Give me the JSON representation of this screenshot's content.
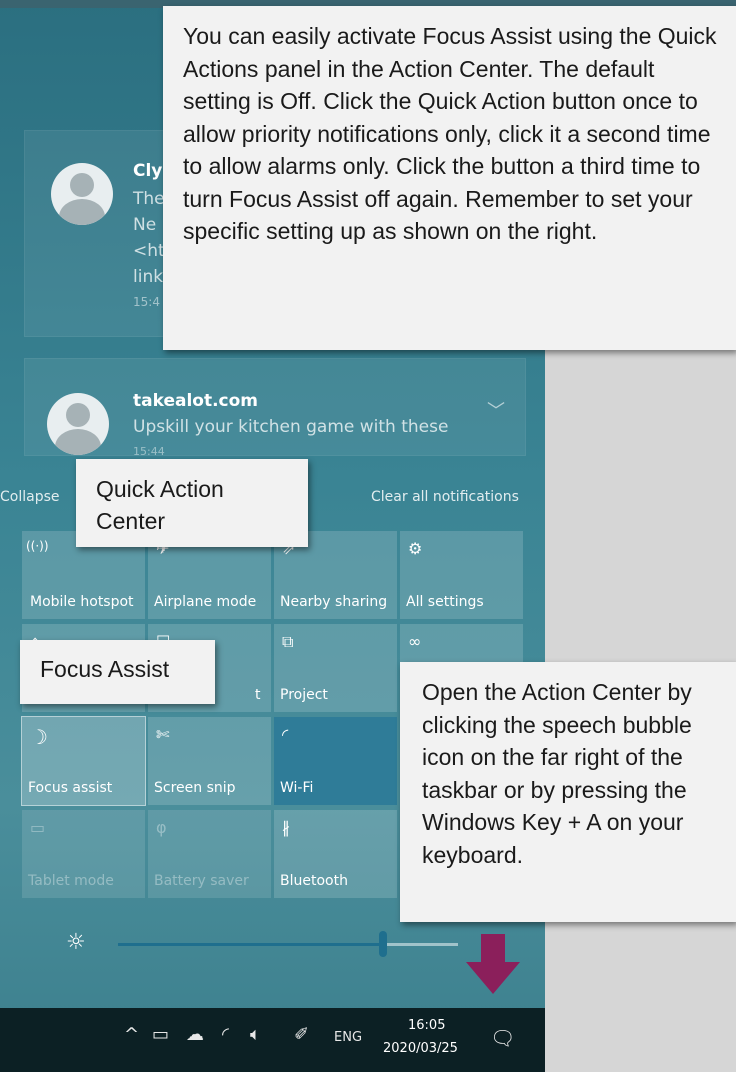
{
  "notifications": [
    {
      "sender": "Cly",
      "lines": [
        "The",
        "Ne",
        "<ht",
        "link"
      ],
      "time": "15:4"
    },
    {
      "sender": "takealot.com",
      "lines": [
        "Upskill your kitchen game with these"
      ],
      "time": "15:44"
    }
  ],
  "action_center": {
    "collapse_label": "Collapse",
    "clear_label": "Clear all notifications",
    "tiles": [
      {
        "label": "Mobile hotspot",
        "icon": "mobile-hotspot-icon",
        "glyph": "((·))"
      },
      {
        "label": "Airplane mode",
        "icon": "airplane-icon",
        "glyph": "✈"
      },
      {
        "label": "Nearby sharing",
        "icon": "nearby-sharing-icon",
        "glyph": "⇗"
      },
      {
        "label": "All settings",
        "icon": "gear-icon",
        "glyph": "⚙"
      },
      {
        "label": "",
        "icon": "location-icon",
        "glyph": "⌂"
      },
      {
        "label": "t",
        "icon": "night-light-icon",
        "glyph": "☐"
      },
      {
        "label": "Project",
        "icon": "project-icon",
        "glyph": "⧉"
      },
      {
        "label": "",
        "icon": "network-icon",
        "glyph": "∞"
      },
      {
        "label": "Focus assist",
        "icon": "moon-icon",
        "glyph": "☽"
      },
      {
        "label": "Screen snip",
        "icon": "scissors-icon",
        "glyph": "✄"
      },
      {
        "label": "Wi-Fi",
        "icon": "wifi-icon",
        "glyph": "◜"
      },
      {
        "label": "Tablet mode",
        "icon": "tablet-icon",
        "glyph": "▭"
      },
      {
        "label": "Battery saver",
        "icon": "battery-saver-icon",
        "glyph": "φ"
      },
      {
        "label": "Bluetooth",
        "icon": "bluetooth-icon",
        "glyph": "∦"
      }
    ],
    "brightness": 0.78
  },
  "taskbar": {
    "language": "ENG",
    "time": "16:05",
    "date": "2020/03/25"
  },
  "callouts": {
    "main": "You can easily activate Focus Assist using the Quick Actions panel in the Action Center. The default setting is Off.  Click the Quick Action button once to allow priority notifications only, click it a second time to allow alarms only.  Click the button a third time to turn Focus Assist off again. Remember to set your specific setting up as shown on the right.",
    "quick_action_center": "Quick Action Center",
    "focus_assist": "Focus Assist",
    "open_action_center": "Open the Action Center by clicking the speech bubble icon on the far right of the taskbar or by pressing the Windows Key + A on your keyboard."
  },
  "colors": {
    "arrow": "#8b1f5b",
    "accent": "#2f7c98"
  }
}
